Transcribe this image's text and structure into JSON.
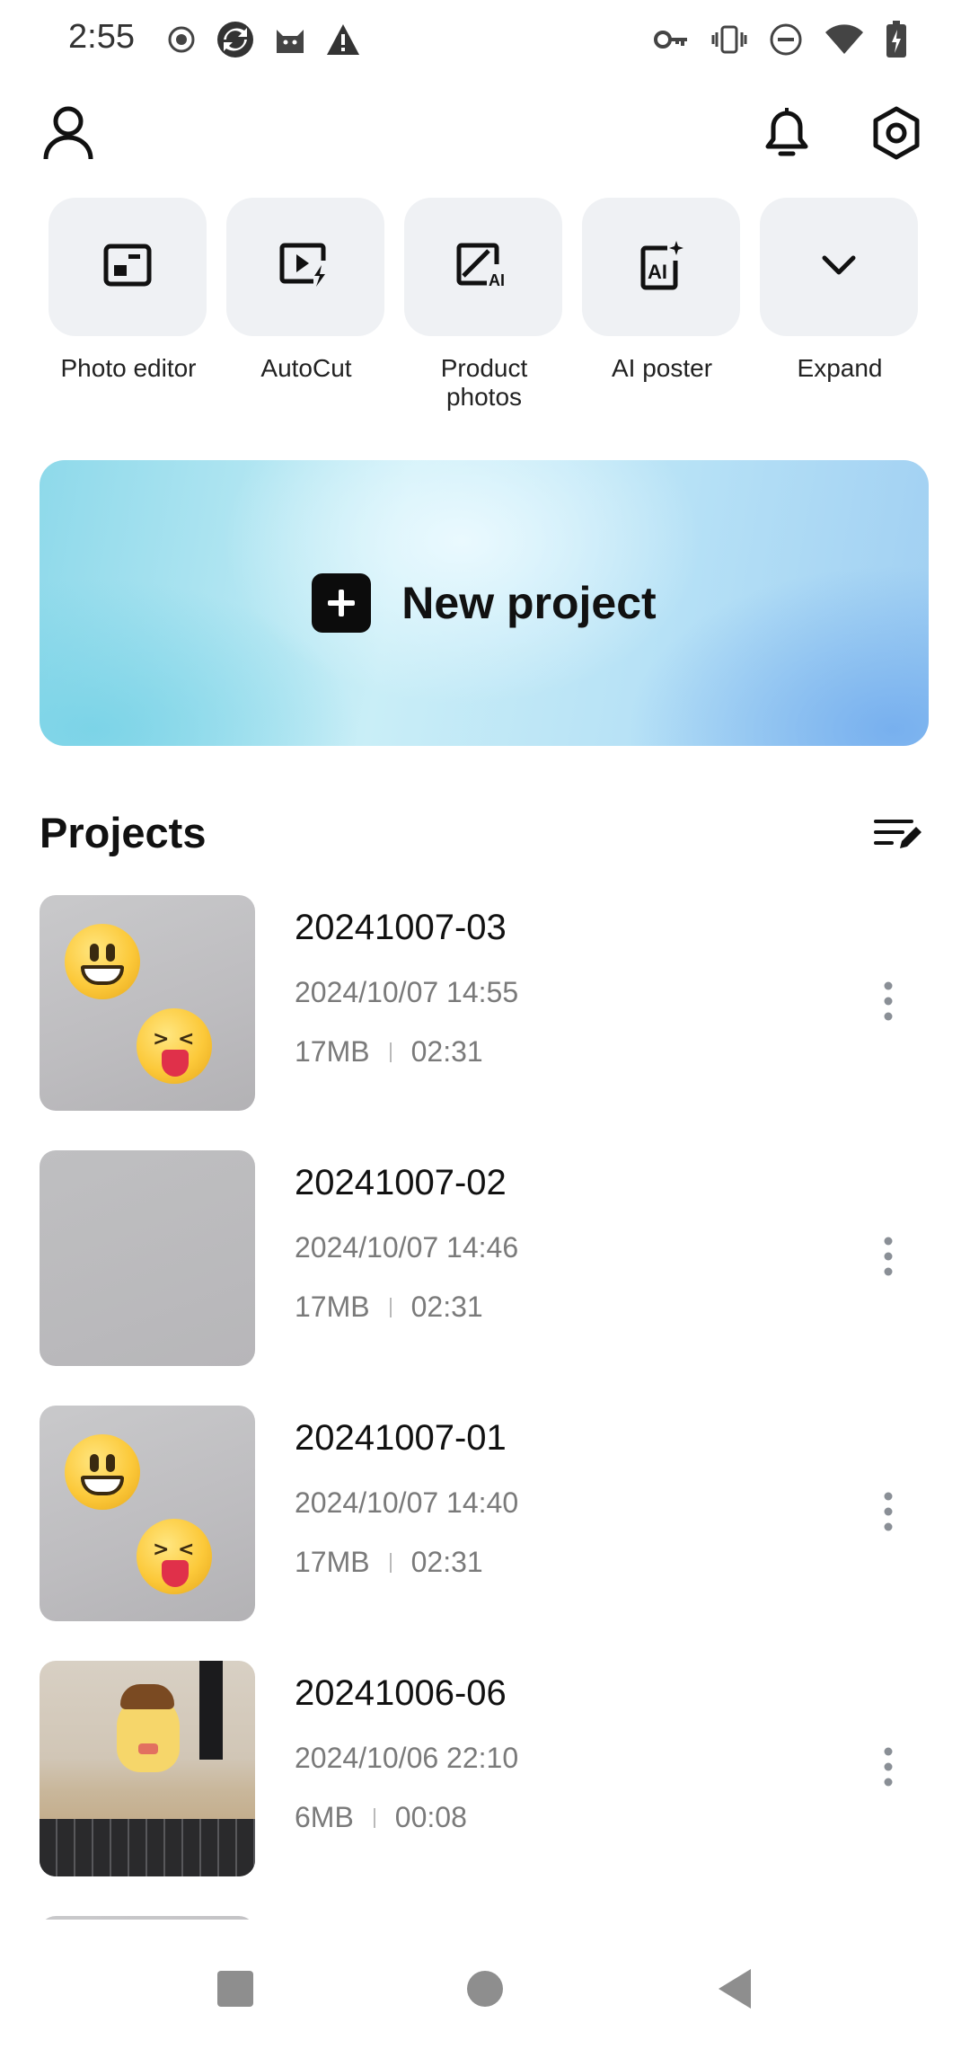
{
  "status_bar": {
    "time": "2:55",
    "left_icons": [
      "record-icon",
      "sync-icon",
      "cat-app-icon",
      "warning-icon"
    ],
    "right_icons": [
      "vpn-key-icon",
      "vibrate-icon",
      "do-not-disturb-icon",
      "wifi-icon",
      "battery-charging-icon"
    ]
  },
  "top_bar": {
    "icons": [
      "profile-icon",
      "bell-icon",
      "settings-icon"
    ]
  },
  "tools": [
    {
      "label": "Photo editor",
      "icon": "photo-editor-icon"
    },
    {
      "label": "AutoCut",
      "icon": "autocut-icon"
    },
    {
      "label": "Product\nphotos",
      "icon": "product-photos-icon"
    },
    {
      "label": "AI poster",
      "icon": "ai-poster-icon"
    },
    {
      "label": "Expand",
      "icon": "chevron-down-icon"
    }
  ],
  "new_project": {
    "label": "New project",
    "icon": "plus-icon"
  },
  "projects": {
    "title": "Projects",
    "manage_icon": "edit-list-icon",
    "items": [
      {
        "name": "20241007-03",
        "date": "2024/10/07 14:55",
        "size": "17MB",
        "duration": "02:31"
      },
      {
        "name": "20241007-02",
        "date": "2024/10/07 14:46",
        "size": "17MB",
        "duration": "02:31"
      },
      {
        "name": "20241007-01",
        "date": "2024/10/07 14:40",
        "size": "17MB",
        "duration": "02:31"
      },
      {
        "name": "20241006-06",
        "date": "2024/10/06 22:10",
        "size": "6MB",
        "duration": "00:08"
      }
    ]
  },
  "nav_bar": {
    "icons": [
      "recents-icon",
      "home-icon",
      "back-icon"
    ]
  },
  "colors": {
    "tile_bg": "#eff1f4",
    "meta_text": "#7a7a7a",
    "banner_accent": "#8ed9ea"
  }
}
